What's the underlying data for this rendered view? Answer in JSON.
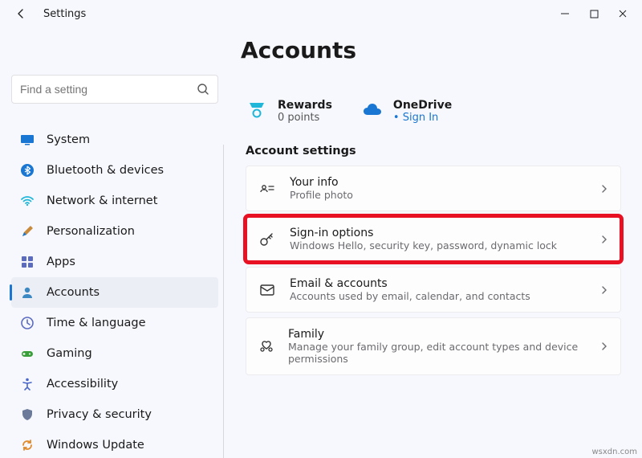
{
  "window": {
    "app_title": "Settings"
  },
  "page": {
    "title": "Accounts"
  },
  "search": {
    "placeholder": "Find a setting"
  },
  "sidebar": {
    "items": [
      {
        "label": "System"
      },
      {
        "label": "Bluetooth & devices"
      },
      {
        "label": "Network & internet"
      },
      {
        "label": "Personalization"
      },
      {
        "label": "Apps"
      },
      {
        "label": "Accounts"
      },
      {
        "label": "Time & language"
      },
      {
        "label": "Gaming"
      },
      {
        "label": "Accessibility"
      },
      {
        "label": "Privacy & security"
      },
      {
        "label": "Windows Update"
      }
    ],
    "active_index": 5
  },
  "status": {
    "rewards": {
      "title": "Rewards",
      "subtitle": "0 points"
    },
    "onedrive": {
      "title": "OneDrive",
      "subtitle": "• Sign In"
    }
  },
  "section_title": "Account settings",
  "cards": [
    {
      "title": "Your info",
      "subtitle": "Profile photo"
    },
    {
      "title": "Sign-in options",
      "subtitle": "Windows Hello, security key, password, dynamic lock"
    },
    {
      "title": "Email & accounts",
      "subtitle": "Accounts used by email, calendar, and contacts"
    },
    {
      "title": "Family",
      "subtitle": "Manage your family group, edit account types and device permissions"
    }
  ],
  "attribution": "wsxdn.com"
}
